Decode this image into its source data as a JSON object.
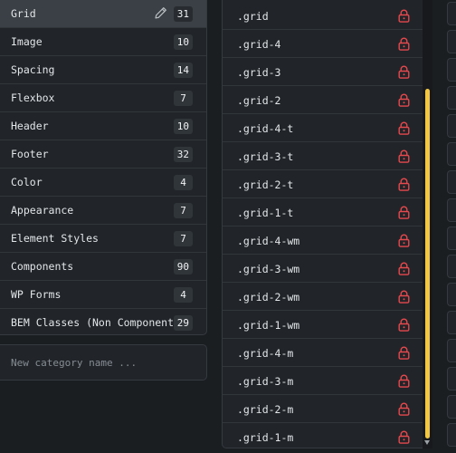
{
  "categories": [
    {
      "label": "Grid",
      "count": "31",
      "active": true
    },
    {
      "label": "Image",
      "count": "10"
    },
    {
      "label": "Spacing",
      "count": "14"
    },
    {
      "label": "Flexbox",
      "count": "7"
    },
    {
      "label": "Header",
      "count": "10"
    },
    {
      "label": "Footer",
      "count": "32"
    },
    {
      "label": "Color",
      "count": "4"
    },
    {
      "label": "Appearance",
      "count": "7"
    },
    {
      "label": "Element Styles",
      "count": "7"
    },
    {
      "label": "Components",
      "count": "90"
    },
    {
      "label": "WP Forms",
      "count": "4"
    },
    {
      "label": "BEM Classes (Non Component)",
      "count": "29"
    }
  ],
  "new_category": {
    "placeholder": "New category name ..."
  },
  "classes": [
    ".grid",
    ".grid-4",
    ".grid-3",
    ".grid-2",
    ".grid-4-t",
    ".grid-3-t",
    ".grid-2-t",
    ".grid-1-t",
    ".grid-4-wm",
    ".grid-3-wm",
    ".grid-2-wm",
    ".grid-1-wm",
    ".grid-4-m",
    ".grid-3-m",
    ".grid-2-m",
    ".grid-1-m"
  ],
  "colors": {
    "lock": "#e5484d",
    "scroll_thumb": "#f2c744",
    "active_row": "#3b4046"
  },
  "icons": {
    "edit": "pencil-icon",
    "locked": "lock-icon",
    "scroll_down": "scroll-down-arrow-icon"
  }
}
